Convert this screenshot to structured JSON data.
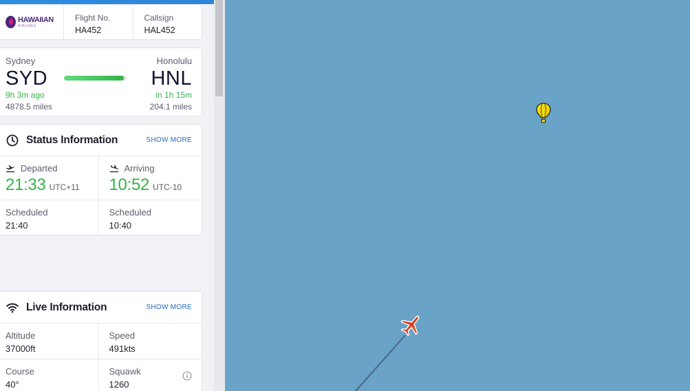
{
  "header": {
    "airline_logo_line1": "HAWAIIAN",
    "airline_logo_line2": "AIRLINES",
    "flight_no_label": "Flight No.",
    "flight_no_value": "HA452",
    "callsign_label": "Callsign",
    "callsign_value": "HAL452"
  },
  "route": {
    "origin_city": "Sydney",
    "origin_code": "SYD",
    "origin_elapsed": "9h 3m ago",
    "origin_distance": "4878.5 miles",
    "destination_city": "Honolulu",
    "destination_code": "HNL",
    "destination_remaining": "in 1h 15m",
    "destination_distance": "204.1 miles",
    "progress_fraction": 0.96
  },
  "status": {
    "title": "Status Information",
    "show_more": "SHOW MORE",
    "departed_label": "Departed",
    "departed_time": "21:33",
    "departed_tz": "UTC+11",
    "arriving_label": "Arriving",
    "arriving_time": "10:52",
    "arriving_tz": "UTC-10",
    "sched_dep_label": "Scheduled",
    "sched_dep_value": "21:40",
    "sched_arr_label": "Scheduled",
    "sched_arr_value": "10:40"
  },
  "live": {
    "title": "Live Information",
    "show_more": "SHOW MORE",
    "altitude_label": "Altitude",
    "altitude_value": "37000ft",
    "speed_label": "Speed",
    "speed_value": "491kts",
    "course_label": "Course",
    "course_value": "40°",
    "squawk_label": "Squawk",
    "squawk_value": "1260"
  },
  "colors": {
    "ocean": "#6aa3c8",
    "accent_green": "#35b24a",
    "link_blue": "#2768b8",
    "plane_red": "#d9452b",
    "balloon_yellow": "#f5d90a"
  },
  "icons": [
    "clock-icon",
    "departure-icon",
    "arrival-icon",
    "wifi-icon",
    "info-icon",
    "plane-icon",
    "balloon-icon"
  ]
}
